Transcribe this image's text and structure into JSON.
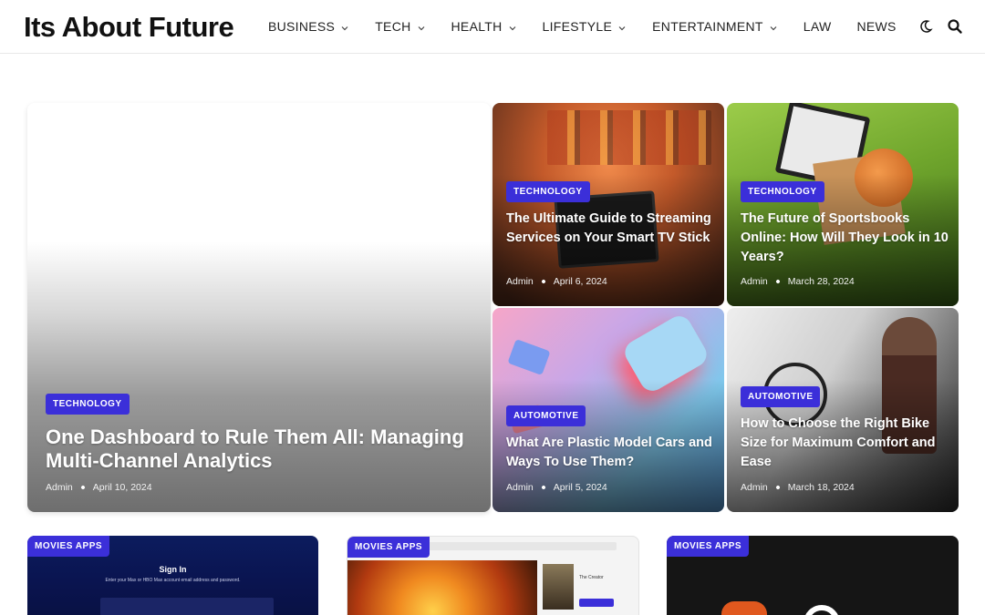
{
  "site": {
    "logo": "Its About Future"
  },
  "nav": {
    "items": [
      {
        "label": "BUSINESS",
        "has_dropdown": true
      },
      {
        "label": "TECH",
        "has_dropdown": true
      },
      {
        "label": "HEALTH",
        "has_dropdown": true
      },
      {
        "label": "LIFESTYLE",
        "has_dropdown": true
      },
      {
        "label": "ENTERTAINMENT",
        "has_dropdown": true
      },
      {
        "label": "LAW",
        "has_dropdown": false
      },
      {
        "label": "NEWS",
        "has_dropdown": false
      }
    ],
    "icons": [
      "moon-icon",
      "search-icon"
    ]
  },
  "featured": {
    "main": {
      "category": "TECHNOLOGY",
      "title": "One Dashboard to Rule Them All: Managing Multi-Channel Analytics",
      "author": "Admin",
      "date": "April 10, 2024"
    },
    "side": [
      {
        "category": "TECHNOLOGY",
        "title": "The Ultimate Guide to Streaming Services on Your Smart TV Stick",
        "author": "Admin",
        "date": "April 6, 2024"
      },
      {
        "category": "TECHNOLOGY",
        "title": "The Future of Sportsbooks Online: How Will They Look in 10 Years?",
        "author": "Admin",
        "date": "March 28, 2024"
      },
      {
        "category": "AUTOMOTIVE",
        "title": "What Are Plastic Model Cars and Ways To Use Them?",
        "author": "Admin",
        "date": "April 5, 2024"
      },
      {
        "category": "AUTOMOTIVE",
        "title": "How to Choose the Right Bike Size for Maximum Comfort and Ease",
        "author": "Admin",
        "date": "March 18, 2024"
      }
    ]
  },
  "latest": [
    {
      "category": "MOVIES APPS",
      "preview_heading": "Sign In",
      "preview_sub": "Enter your Max or HBO Max account email address and password."
    },
    {
      "category": "MOVIES APPS",
      "preview_heading": "The Creator"
    },
    {
      "category": "MOVIES APPS"
    }
  ],
  "colors": {
    "badge": "#3b2fd9",
    "header_border": "#e8e8e8"
  }
}
